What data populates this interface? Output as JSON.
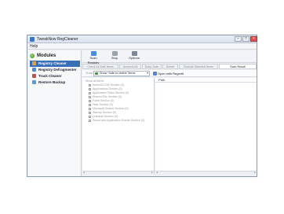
{
  "window": {
    "title": "TweakNow RegCleaner",
    "controls": [
      "–",
      "□",
      "×"
    ]
  },
  "menu": {
    "help": "Help"
  },
  "sidebar": {
    "heading": "Modules",
    "items": [
      {
        "label": "Registry Cleaner",
        "icon": "registry-cleaner-icon",
        "active": true
      },
      {
        "label": "Registry Defragmenter",
        "icon": "defrag-icon",
        "active": false
      },
      {
        "label": "Track Cleaner",
        "icon": "track-cleaner-icon",
        "active": false
      },
      {
        "label": "Restore Backup",
        "icon": "restore-icon",
        "active": false
      }
    ]
  },
  "toolbar": {
    "scan_label": "Scan Registry",
    "stop_label": "Stop",
    "options_label": "Options"
  },
  "tabs": [
    "Check All Safe Items",
    "Uncheck All",
    "Deep Scan",
    "Delete",
    "Exclude Selected Items",
    "Scan Result"
  ],
  "actionbar": {
    "show_label": "Show",
    "filter_value": "Show 'Safe to delete' items",
    "open_label": "Open with Regedit"
  },
  "tree": {
    "root": "Show all items",
    "items": [
      "ActiveX/COM Section (0)",
      "Applications Section (0)",
      "Application Paths Section (0)",
      "Shared Dlls Section (0)",
      "Fonts Section (0)",
      "Help Section (0)",
      "Microsoft Shared Section (0)",
      "Startup Section (0)",
      "Uninstall Section (0)",
      "Sound and Application Events Section (0)"
    ]
  },
  "detail": {
    "header": "Path"
  },
  "colors": {
    "accent": "#3a6fb5",
    "border": "#8a9bb0"
  }
}
